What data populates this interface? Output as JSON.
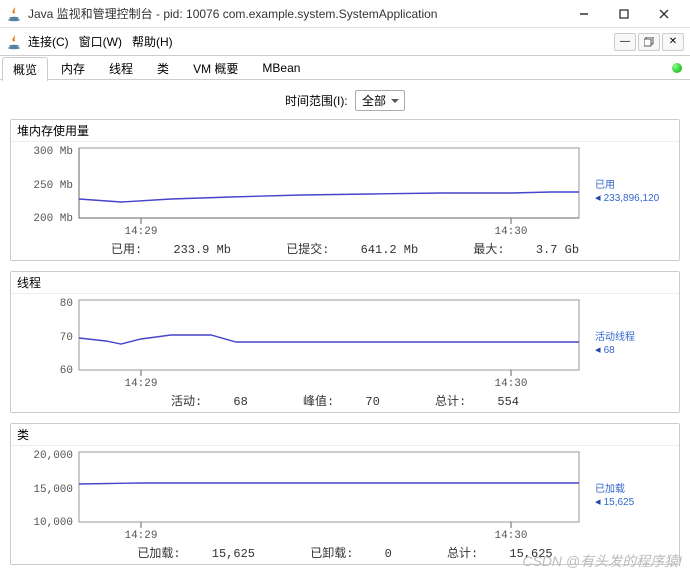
{
  "window": {
    "title": "Java 监视和管理控制台 - pid: 10076 com.example.system.SystemApplication"
  },
  "menu": {
    "connect": "连接(C)",
    "window": "窗口(W)",
    "help": "帮助(H)"
  },
  "tabs": {
    "overview": "概览",
    "memory": "内存",
    "threads": "线程",
    "classes": "类",
    "vm": "VM 概要",
    "mbean": "MBean"
  },
  "timerange": {
    "label": "时间范围(I):",
    "value": "全部"
  },
  "heap": {
    "title": "堆内存使用量",
    "legend_name": "已用",
    "legend_value": "233,896,120",
    "stats": {
      "used_label": "已用:",
      "used": "233.9  Mb",
      "committed_label": "已提交:",
      "committed": "641.2  Mb",
      "max_label": "最大:",
      "max": "3.7  Gb"
    }
  },
  "threads": {
    "title": "线程",
    "legend_name": "活动线程",
    "legend_value": "68",
    "stats": {
      "live_label": "活动:",
      "live": "68",
      "peak_label": "峰值:",
      "peak": "70",
      "total_label": "总计:",
      "total": "554"
    }
  },
  "classes": {
    "title": "类",
    "legend_name": "已加载",
    "legend_value": "15,625",
    "stats": {
      "loaded_label": "已加载:",
      "loaded": "15,625",
      "unloaded_label": "已卸载:",
      "unloaded": "0",
      "total_label": "总计:",
      "total": "15,625"
    }
  },
  "watermark": "CSDN @有头发的程序猿!",
  "chart_data": [
    {
      "type": "line",
      "name": "heap",
      "ylabel": "Mb",
      "ylim": [
        200,
        300
      ],
      "yticks": [
        200,
        250,
        300
      ],
      "xlabel": "",
      "xticks": [
        "14:29",
        "14:30"
      ],
      "series": [
        {
          "name": "已用",
          "values_approx": [
            225,
            223,
            226,
            227,
            230,
            231,
            232,
            232,
            233,
            234
          ]
        }
      ]
    },
    {
      "type": "line",
      "name": "threads",
      "ylabel": "",
      "ylim": [
        60,
        80
      ],
      "yticks": [
        60,
        70,
        80
      ],
      "xticks": [
        "14:29",
        "14:30"
      ],
      "series": [
        {
          "name": "活动线程",
          "values_approx": [
            69,
            68,
            68,
            70,
            70,
            68,
            68,
            68,
            68,
            68
          ]
        }
      ]
    },
    {
      "type": "line",
      "name": "classes",
      "ylabel": "",
      "ylim": [
        10000,
        20000
      ],
      "yticks": [
        10000,
        15000,
        20000
      ],
      "xticks": [
        "14:29",
        "14:30"
      ],
      "series": [
        {
          "name": "已加载",
          "values_approx": [
            15600,
            15610,
            15615,
            15620,
            15622,
            15624,
            15625,
            15625,
            15625,
            15625
          ]
        }
      ]
    }
  ]
}
